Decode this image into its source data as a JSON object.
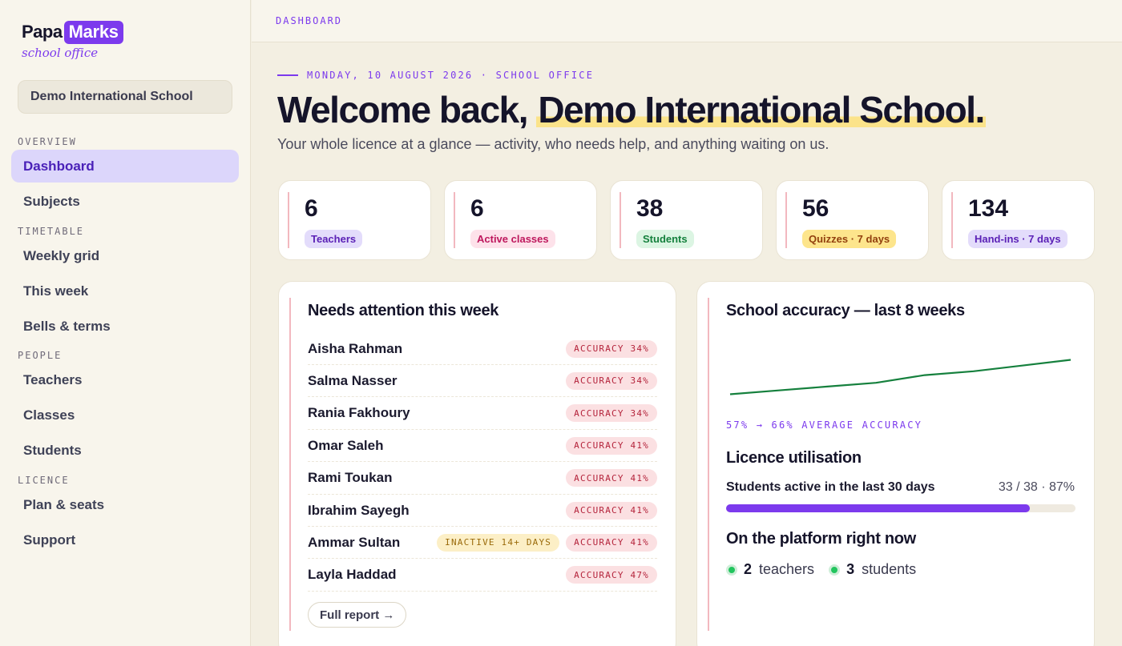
{
  "brand": {
    "name_part1": "Papa",
    "name_part2": "Marks",
    "subtitle": "school office"
  },
  "school_name": "Demo International School",
  "nav": {
    "sections": [
      "OVERVIEW",
      "TIMETABLE",
      "PEOPLE",
      "LICENCE"
    ],
    "items": [
      {
        "label": "Dashboard",
        "active": true
      },
      {
        "label": "Subjects"
      },
      {
        "label": "Weekly grid"
      },
      {
        "label": "This week"
      },
      {
        "label": "Bells & terms"
      },
      {
        "label": "Teachers"
      },
      {
        "label": "Classes"
      },
      {
        "label": "Students"
      },
      {
        "label": "Plan & seats"
      },
      {
        "label": "Support"
      }
    ]
  },
  "topbar": {
    "breadcrumb": "DASHBOARD"
  },
  "header": {
    "dateline": "MONDAY, 10 AUGUST 2026 · SCHOOL OFFICE",
    "welcome_prefix": "Welcome back,",
    "welcome_name": "Demo International School.",
    "tagline": "Your whole licence at a glance — activity, who needs help, and anything waiting on us."
  },
  "stats": [
    {
      "value": "6",
      "label": "Teachers",
      "bg": "#e3dcfb",
      "fg": "#5b21b6"
    },
    {
      "value": "6",
      "label": "Active classes",
      "bg": "#fde2ea",
      "fg": "#be185d"
    },
    {
      "value": "38",
      "label": "Students",
      "bg": "#dcf5e3",
      "fg": "#15803d"
    },
    {
      "value": "56",
      "label": "Quizzes · 7 days",
      "bg": "#fde58c",
      "fg": "#92400e"
    },
    {
      "value": "134",
      "label": "Hand-ins · 7 days",
      "bg": "#e3dcfb",
      "fg": "#5b21b6"
    }
  ],
  "attention": {
    "title": "Needs attention this week",
    "rows": [
      {
        "name": "Aisha Rahman",
        "tags": [
          "ACCURACY 34%"
        ]
      },
      {
        "name": "Salma Nasser",
        "tags": [
          "ACCURACY 34%"
        ]
      },
      {
        "name": "Rania Fakhoury",
        "tags": [
          "ACCURACY 34%"
        ]
      },
      {
        "name": "Omar Saleh",
        "tags": [
          "ACCURACY 41%"
        ]
      },
      {
        "name": "Rami Toukan",
        "tags": [
          "ACCURACY 41%"
        ]
      },
      {
        "name": "Ibrahim Sayegh",
        "tags": [
          "ACCURACY 41%"
        ]
      },
      {
        "name": "Ammar Sultan",
        "tags": [
          "INACTIVE 14+ DAYS",
          "ACCURACY 41%"
        ]
      },
      {
        "name": "Layla Haddad",
        "tags": [
          "ACCURACY 47%"
        ]
      }
    ],
    "report_button": "Full report →"
  },
  "accuracy": {
    "title": "School accuracy — last 8 weeks",
    "summary": "57% → 66% AVERAGE ACCURACY",
    "chart_data": {
      "type": "line",
      "x": [
        1,
        2,
        3,
        4,
        5,
        6,
        7,
        8
      ],
      "values": [
        57,
        58,
        59,
        60,
        62,
        63,
        64.5,
        66
      ],
      "color": "#15803d"
    }
  },
  "licence": {
    "title": "Licence utilisation",
    "label": "Students active in the last 30 days",
    "value_text": "33 / 38 · 87%",
    "fraction": 0.87
  },
  "online": {
    "title": "On the platform right now",
    "teachers_count": "2",
    "teachers_label": "teachers",
    "students_count": "3",
    "students_label": "students"
  }
}
